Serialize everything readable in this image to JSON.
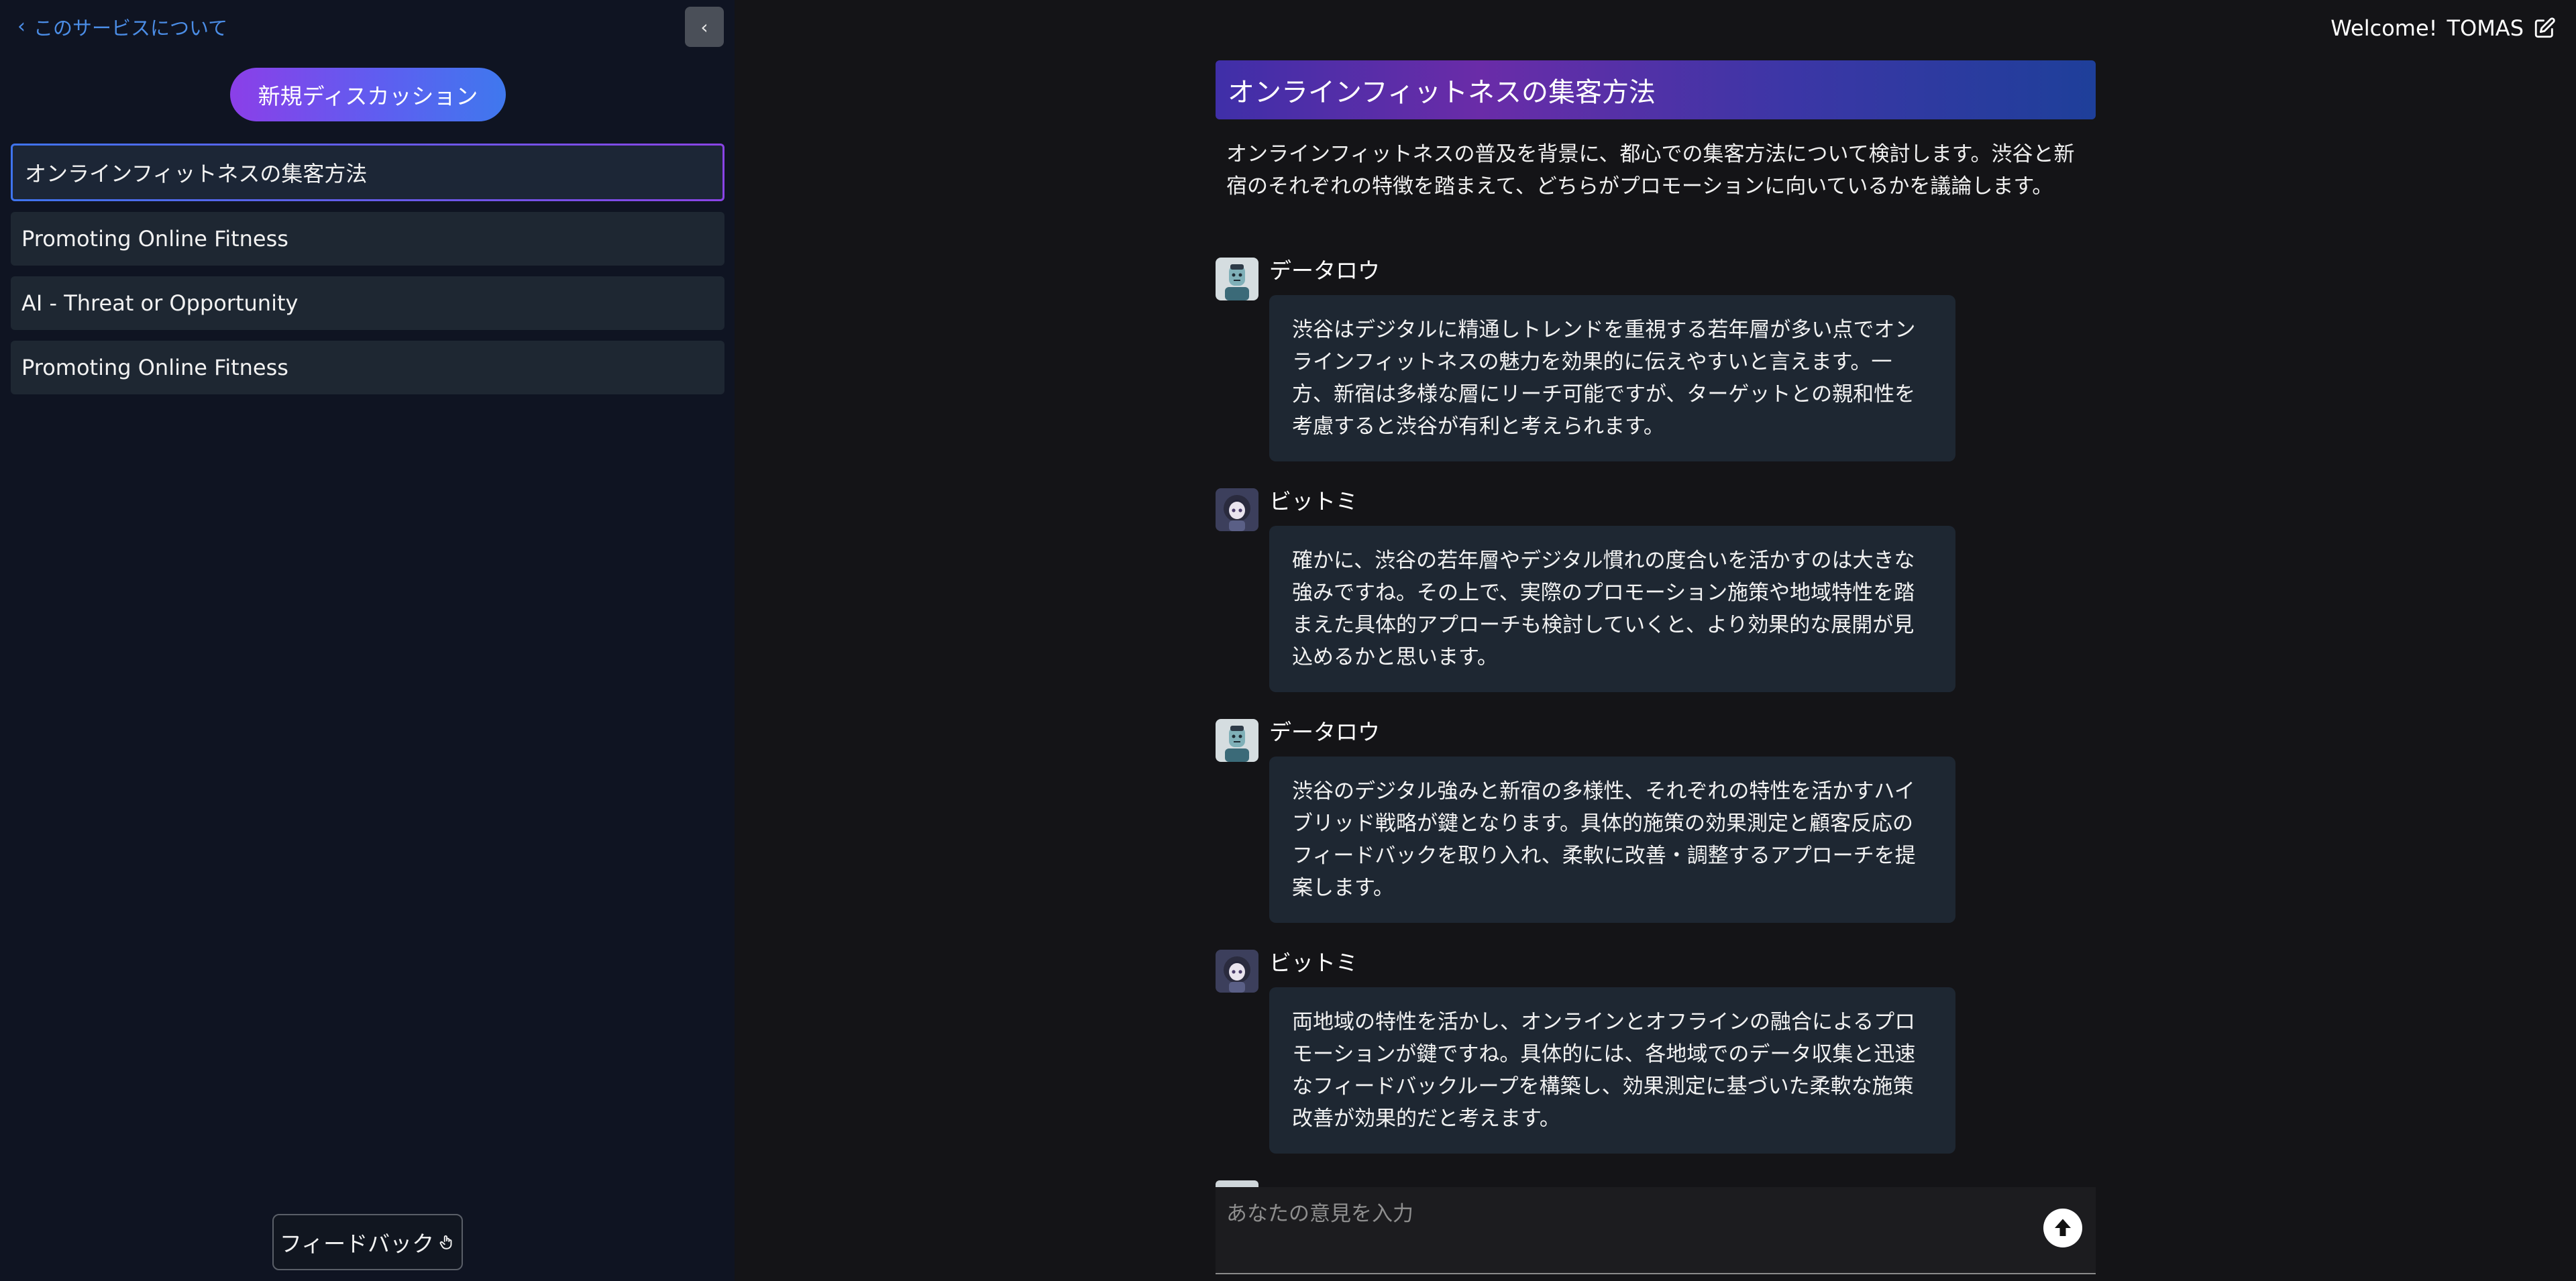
{
  "sidebar": {
    "about_label": "このサービスについて",
    "collapse_label": "‹",
    "new_discussion_label": "新規ディスカッション",
    "threads": [
      {
        "label": "オンラインフィットネスの集客方法"
      },
      {
        "label": "Promoting Online Fitness"
      },
      {
        "label": "AI - Threat or Opportunity"
      },
      {
        "label": "Promoting Online Fitness"
      }
    ],
    "feedback_label": "フィードバック"
  },
  "header": {
    "welcome_label": "Welcome!",
    "user_name": "TOMAS"
  },
  "topic": {
    "title": "オンラインフィットネスの集客方法",
    "description": "オンラインフィットネスの普及を背景に、都心での集客方法について検討します。渋谷と新宿のそれぞれの特徴を踏まえて、どちらがプロモーションに向いているかを議論します。"
  },
  "messages": [
    {
      "speaker": "データロウ",
      "avatar": "robot-avatar",
      "text": "渋谷はデジタルに精通しトレンドを重視する若年層が多い点でオンラインフィットネスの魅力を効果的に伝えやすいと言えます。一方、新宿は多様な層にリーチ可能ですが、ターゲットとの親和性を考慮すると渋谷が有利と考えられます。"
    },
    {
      "speaker": "ビットミ",
      "avatar": "anime-girl-avatar",
      "text": "確かに、渋谷の若年層やデジタル慣れの度合いを活かすのは大きな強みですね。その上で、実際のプロモーション施策や地域特性を踏まえた具体的アプローチも検討していくと、より効果的な展開が見込めるかと思います。"
    },
    {
      "speaker": "データロウ",
      "avatar": "robot-avatar",
      "text": "渋谷のデジタル強みと新宿の多様性、それぞれの特性を活かすハイブリッド戦略が鍵となります。具体的施策の効果測定と顧客反応のフィードバックを取り入れ、柔軟に改善・調整するアプローチを提案します。"
    },
    {
      "speaker": "ビットミ",
      "avatar": "anime-girl-avatar",
      "text": "両地域の特性を活かし、オンラインとオフラインの融合によるプロモーションが鍵ですね。具体的には、各地域でのデータ収集と迅速なフィードバックループを構築し、効果測定に基づいた柔軟な施策改善が効果的だと考えます。"
    }
  ],
  "composer": {
    "placeholder": "あなたの意見を入力"
  },
  "colors": {
    "accent_blue": "#4b8de6",
    "gradient_purple": "#8b3fe8",
    "bubble_bg": "#1e2732",
    "sidebar_bg": "#0f1422",
    "main_bg": "#141417"
  }
}
